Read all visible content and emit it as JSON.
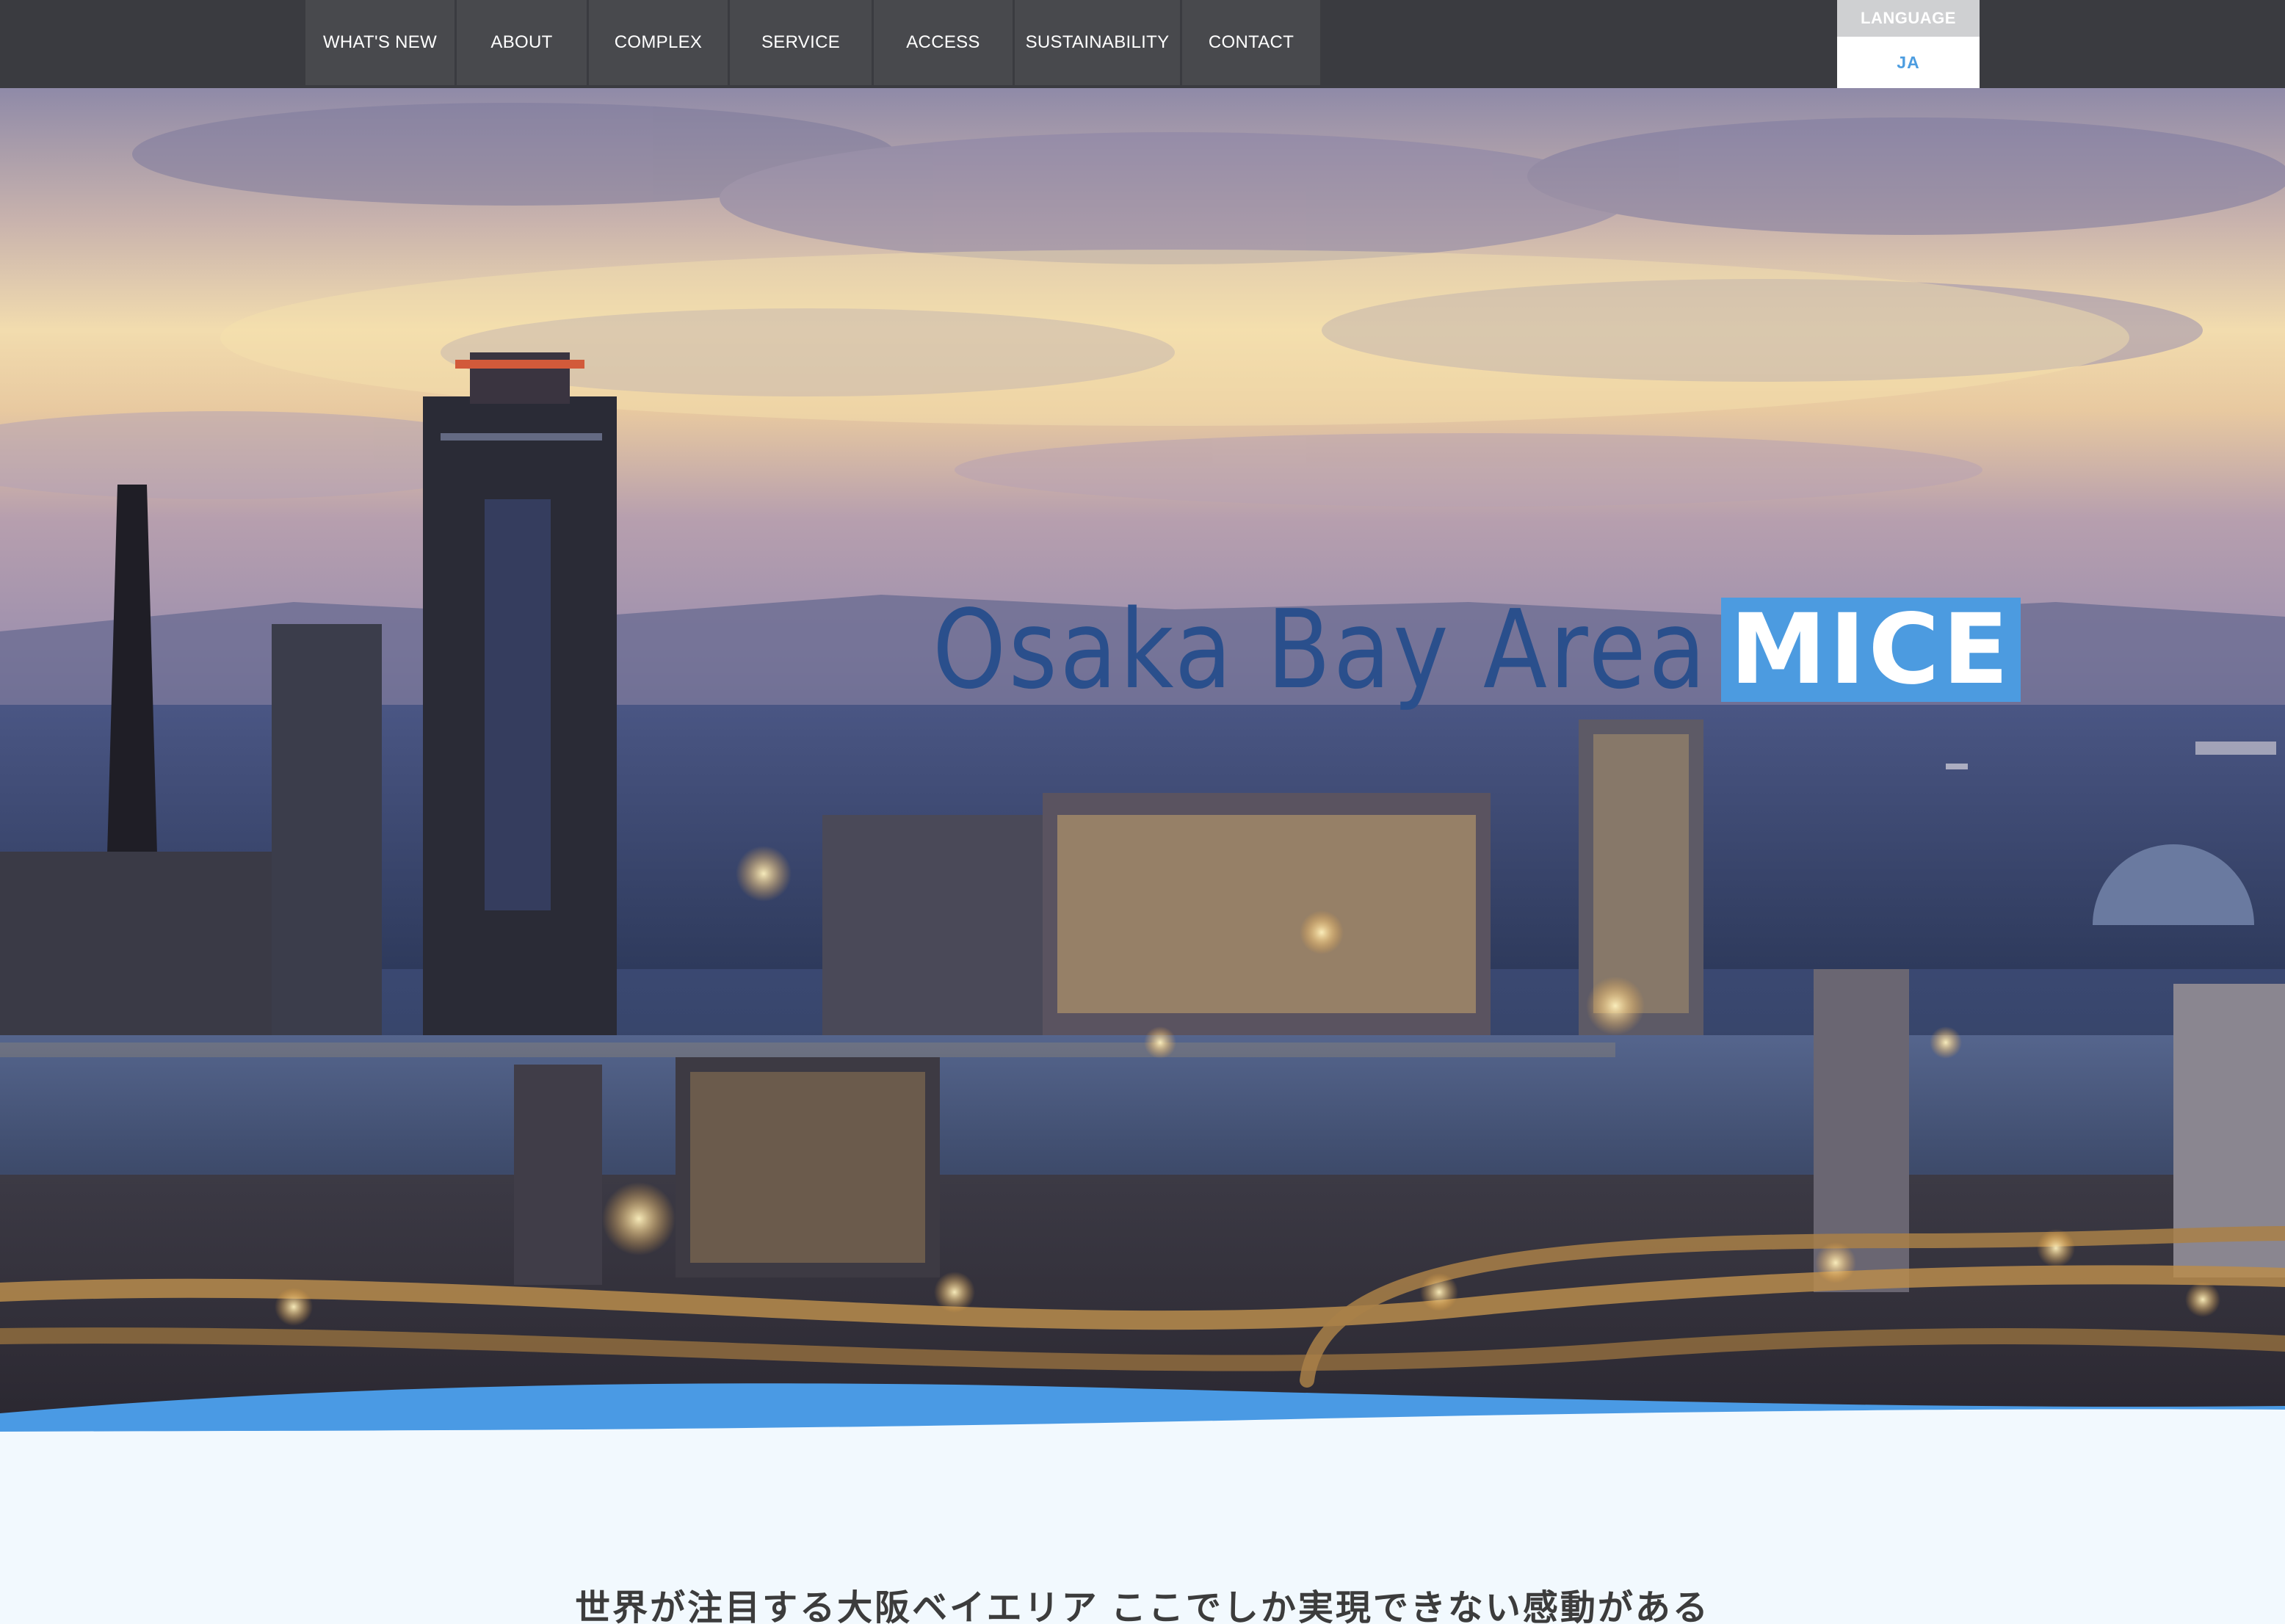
{
  "nav": {
    "items": [
      {
        "label": "WHAT'S NEW"
      },
      {
        "label": "ABOUT"
      },
      {
        "label": "COMPLEX"
      },
      {
        "label": "SERVICE"
      },
      {
        "label": "ACCESS"
      },
      {
        "label": "SUSTAINABILITY"
      },
      {
        "label": "CONTACT"
      }
    ]
  },
  "language": {
    "label": "LANGUAGE",
    "current": "JA"
  },
  "hero": {
    "title": "Osaka Bay Area",
    "badge": "MICE"
  },
  "content": {
    "tagline": "世界が注目する大阪ベイエリア ここでしか実現できない感動がある"
  },
  "colors": {
    "header_bg": "#3a3b40",
    "nav_item_bg": "#48494d",
    "accent_blue": "#4c9be0",
    "title_blue": "#2a4f8c",
    "content_bg": "#f2f9fe"
  }
}
